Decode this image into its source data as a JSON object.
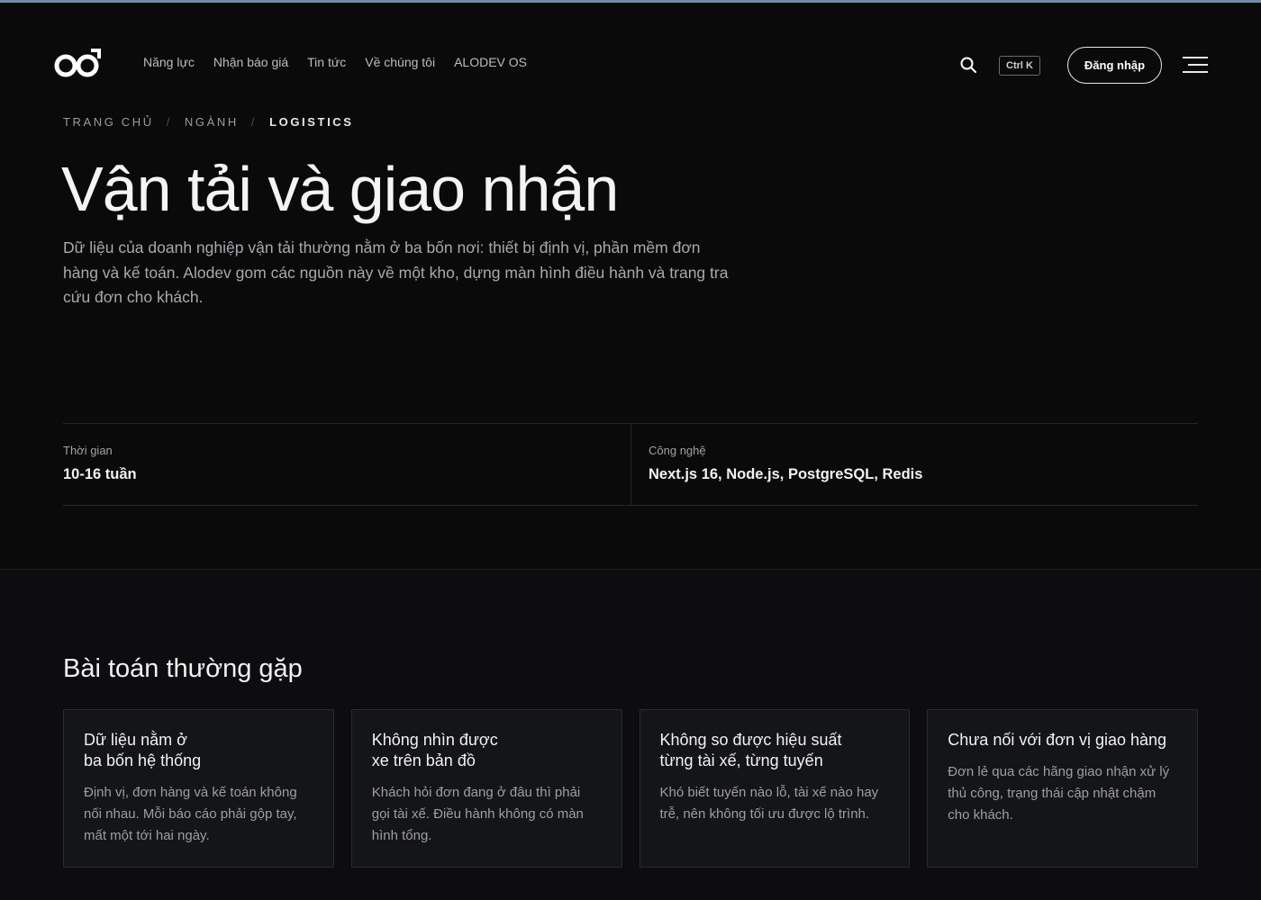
{
  "nav": {
    "items": [
      "Năng lực",
      "Nhận báo giá",
      "Tin tức",
      "Về chúng tôi",
      "ALODEV OS"
    ],
    "shortcut": "Ctrl K",
    "login_label": "Đăng nhập"
  },
  "breadcrumb": {
    "home": "TRANG CHỦ",
    "section": "NGÀNH",
    "current": "LOGISTICS",
    "separator": "/"
  },
  "hero": {
    "title": "Vận tải và giao nhận",
    "lead": "Dữ liệu của doanh nghiệp vận tải thường nằm ở ba bốn nơi: thiết bị định vị, phần mềm đơn hàng và kế toán. Alodev gom các nguồn này về một kho, dựng màn hình điều hành và trang tra cứu đơn cho khách."
  },
  "meta": {
    "duration_label": "Thời gian",
    "duration_value": "10-16 tuần",
    "tech_label": "Công nghệ",
    "tech_value": "Next.js 16, Node.js, PostgreSQL, Redis"
  },
  "problems": {
    "title": "Bài toán thường gặp",
    "cards": [
      {
        "title": "Dữ liệu nằm ở\nba bốn hệ thống",
        "text": "Định vị, đơn hàng và kế toán không nối nhau. Mỗi báo cáo phải gộp tay, mất một tới hai ngày."
      },
      {
        "title": "Không nhìn được\nxe trên bản đồ",
        "text": "Khách hỏi đơn đang ở đâu thì phải gọi tài xế. Điều hành không có màn hình tổng."
      },
      {
        "title": "Không so được hiệu suất\ntừng tài xế, từng tuyến",
        "text": "Khó biết tuyến nào lỗ, tài xế nào hay trễ, nên không tối ưu được lộ trình."
      },
      {
        "title": "Chưa nối với đơn vị giao hàng",
        "text": "Đơn lẻ qua các hãng giao nhận xử lý thủ công, trạng thái cập nhật chậm cho khách."
      }
    ]
  }
}
